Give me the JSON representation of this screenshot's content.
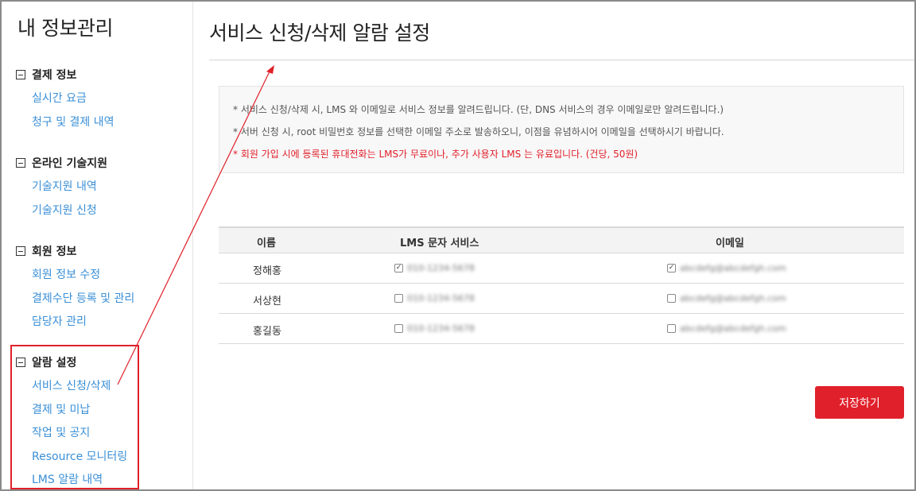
{
  "sidebar": {
    "title": "내 정보관리",
    "groups": [
      {
        "head": "결제 정보",
        "items": [
          "실시간 요금",
          "청구 및 결제 내역"
        ]
      },
      {
        "head": "온라인 기술지원",
        "items": [
          "기술지원 내역",
          "기술지원 신청"
        ]
      },
      {
        "head": "회원 정보",
        "items": [
          "회원 정보 수정",
          "결제수단 등록 및 관리",
          "담당자 관리"
        ]
      },
      {
        "head": "알람 설정",
        "items": [
          "서비스 신청/삭제",
          "결제 및 미납",
          "작업 및 공지",
          "Resource 모니터링",
          "LMS 알람 내역"
        ]
      }
    ]
  },
  "main": {
    "title": "서비스 신청/삭제 알람 설정",
    "notices": [
      "* 서비스 신청/삭제 시, LMS 와 이메일로 서비스 정보를 알려드립니다. (단, DNS 서비스의 경우 이메일로만 알려드립니다.)",
      "* 서버 신청 시, root 비밀번호 정보를 선택한 이메일 주소로 발송하오니, 이점을 유념하시어 이메일을 선택하시기 바랍니다.",
      "* 회원 가입 시에 등록된 휴대전화는 LMS가 무료이나, 추가 사용자 LMS 는 유료입니다. (건당, 50원)"
    ],
    "table": {
      "headers": [
        "이름",
        "LMS 문자 서비스",
        "이메일"
      ],
      "rows": [
        {
          "name": "정해홍",
          "lms_checked": true,
          "lms": "010-1234-5678",
          "email_checked": true,
          "email": "abcdefg@abcdefgh.com"
        },
        {
          "name": "서상현",
          "lms_checked": false,
          "lms": "010-1234-5678",
          "email_checked": false,
          "email": "abcdefg@abcdefgh.com"
        },
        {
          "name": "홍길동",
          "lms_checked": false,
          "lms": "010-1234-5678",
          "email_checked": false,
          "email": "abcdefg@abcdefgh.com"
        }
      ]
    },
    "save_label": "저장하기"
  },
  "colors": {
    "accent": "#e0202a",
    "link": "#3a8fd6"
  }
}
